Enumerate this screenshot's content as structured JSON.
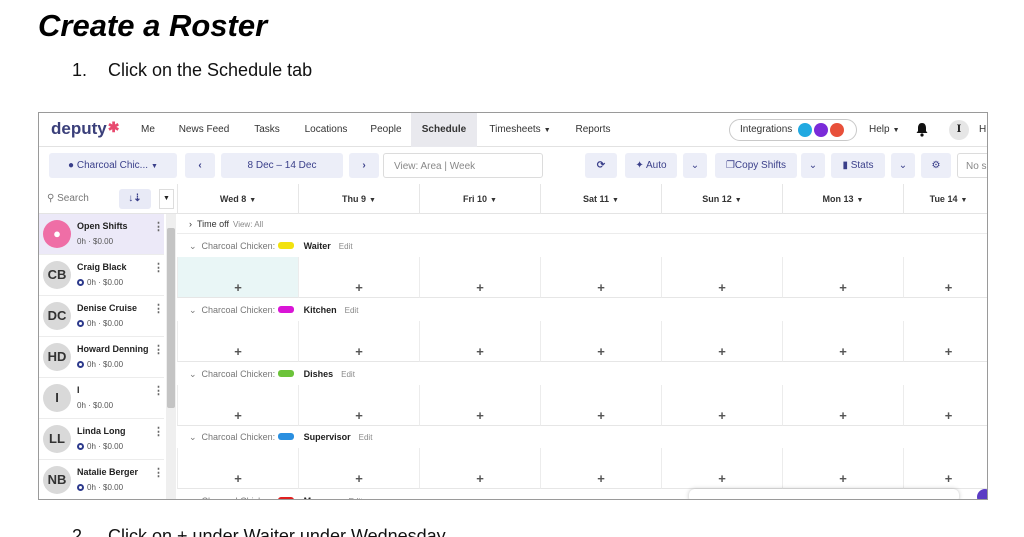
{
  "doc": {
    "title": "Create a Roster",
    "step1_num": "1.",
    "step1_text": "Click on the Schedule tab",
    "step2_num": "2.",
    "step2_text": "Click on + under Waiter under Wednesday"
  },
  "app": {
    "logo": "deputy",
    "logo_mark": "✱",
    "nav": [
      "Me",
      "News Feed",
      "Tasks",
      "Locations",
      "People",
      "Schedule",
      "Timesheets",
      "Reports"
    ],
    "active_tab": "Schedule",
    "integrations_label": "Integrations",
    "integration_colors": [
      "#21a9e1",
      "#7a2bd9",
      "#e8503a"
    ],
    "help_label": "Help",
    "user_initial": "I",
    "user_trunc": "H"
  },
  "toolbar": {
    "location": "Charcoal Chic...",
    "date_range": "8 Dec – 14 Dec",
    "view": "View: Area | Week",
    "auto": "Auto",
    "copy_shifts": "Copy Shifts",
    "stats": "Stats",
    "no_label": "No s"
  },
  "header": {
    "search_placeholder": "Search",
    "sort_icon": "↓⇣",
    "days": [
      "Wed 8",
      "Thu 9",
      "Fri 10",
      "Sat 11",
      "Sun 12",
      "Mon 13",
      "Tue 14"
    ]
  },
  "staff": [
    {
      "initials": "",
      "name": "Open Shifts",
      "hours": "0h · $0.00"
    },
    {
      "initials": "CB",
      "name": "Craig Black",
      "hours": "0h · $0.00"
    },
    {
      "initials": "DC",
      "name": "Denise Cruise",
      "hours": "0h · $0.00"
    },
    {
      "initials": "HD",
      "name": "Howard Denning",
      "hours": "0h · $0.00"
    },
    {
      "initials": "I",
      "name": "I",
      "hours": "0h · $0.00"
    },
    {
      "initials": "LL",
      "name": "Linda Long",
      "hours": "0h · $0.00"
    },
    {
      "initials": "NB",
      "name": "Natalie Berger",
      "hours": "0h · $0.00"
    }
  ],
  "grid": {
    "time_off_label": "Time off",
    "time_off_view": "View: All",
    "area_name": "Charcoal Chicken",
    "edit_label": "Edit",
    "plus": "+",
    "areas": [
      {
        "role": "Waiter",
        "color": "#f2e20f"
      },
      {
        "role": "Kitchen",
        "color": "#d915d6"
      },
      {
        "role": "Dishes",
        "color": "#6cc33a"
      },
      {
        "role": "Supervisor",
        "color": "#2a8fe0"
      },
      {
        "role": "Manager",
        "color": "#e02020"
      }
    ]
  }
}
